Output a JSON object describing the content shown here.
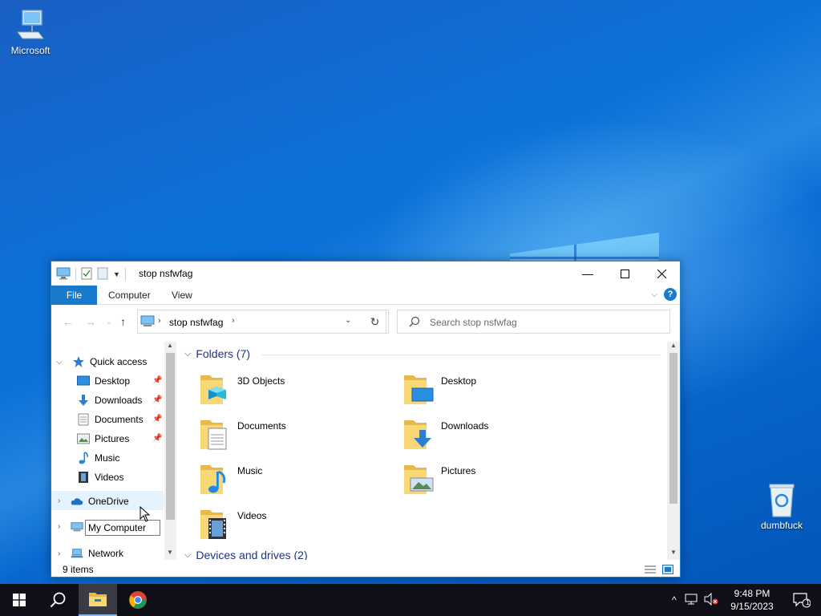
{
  "desktop": {
    "icons": [
      {
        "label": "Microsoft"
      },
      {
        "label": "dumbfuck"
      }
    ]
  },
  "explorer": {
    "title": "stop nsfwfag",
    "ribbon": {
      "file": "File",
      "computer": "Computer",
      "view": "View",
      "help": "?"
    },
    "address": {
      "path": "stop nsfwfag"
    },
    "search": {
      "placeholder": "Search stop nsfwfag"
    },
    "nav": {
      "quick_access": "Quick access",
      "quick_items": [
        "Desktop",
        "Downloads",
        "Documents",
        "Pictures",
        "Music",
        "Videos"
      ],
      "onedrive": "OneDrive",
      "network": "Network"
    },
    "tooltip": "My Computer",
    "groups": {
      "folders": "Folders (7)",
      "devices": "Devices and drives (2)"
    },
    "folders": [
      "3D Objects",
      "Desktop",
      "Documents",
      "Downloads",
      "Music",
      "Pictures",
      "Videos"
    ],
    "status": "9 items"
  },
  "taskbar": {
    "time": "9:48 PM",
    "date": "9/15/2023",
    "notifications": "1"
  },
  "colors": {
    "accent": "#1979ca",
    "taskbar": "#0f0f17"
  }
}
